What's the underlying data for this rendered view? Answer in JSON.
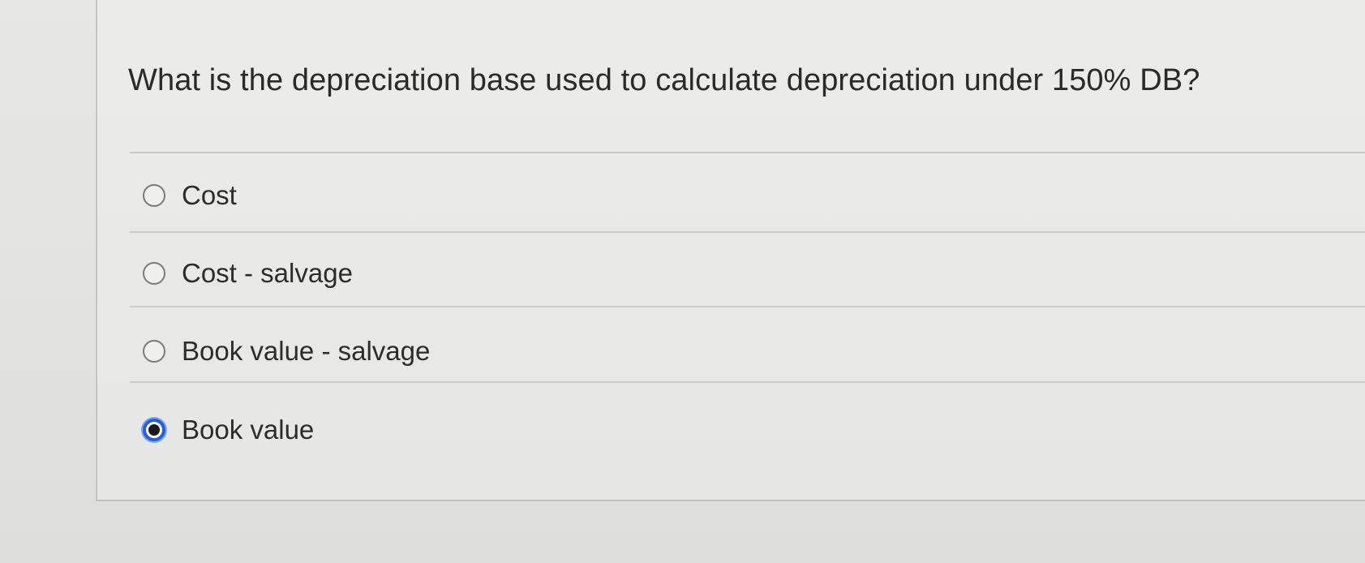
{
  "question": {
    "text": "What is the depreciation base used to calculate depreciation under 150% DB?"
  },
  "options": [
    {
      "label": "Cost",
      "selected": false
    },
    {
      "label": "Cost - salvage",
      "selected": false
    },
    {
      "label": "Book value - salvage",
      "selected": false
    },
    {
      "label": "Book value",
      "selected": true
    }
  ],
  "colors": {
    "selected_radio_ring": "#2460d8",
    "text": "#2c2c2c"
  }
}
